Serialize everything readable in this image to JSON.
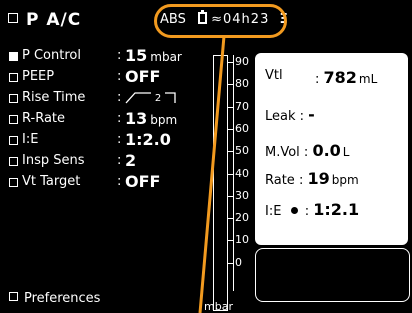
{
  "mode": {
    "title": "P A/C"
  },
  "status": {
    "abs_label": "ABS",
    "battery_time": "≈04h23",
    "marker_glyph": "Ξ"
  },
  "params": [
    {
      "label": "P Control",
      "value": "15",
      "unit": "mbar",
      "selected": true
    },
    {
      "label": "PEEP",
      "value": "OFF",
      "unit": ""
    },
    {
      "label": "Rise Time",
      "value": "2",
      "unit": ""
    },
    {
      "label": "R-Rate",
      "value": "13",
      "unit": "bpm"
    },
    {
      "label": "I:E",
      "value": "1:2.0",
      "unit": ""
    },
    {
      "label": "Insp Sens",
      "value": "2",
      "unit": ""
    },
    {
      "label": "Vt Target",
      "value": "OFF",
      "unit": ""
    }
  ],
  "preferences_label": "Preferences",
  "gauge": {
    "unit": "mbar",
    "ticks": [
      "90",
      "80",
      "70",
      "60",
      "50",
      "40",
      "30",
      "20",
      "10",
      "0"
    ]
  },
  "measured": {
    "vti": {
      "label": "Vtl",
      "value": "782",
      "unit": "mL"
    },
    "leak": {
      "label": "Leak :",
      "value": "-"
    },
    "mvol": {
      "label": "M.Vol :",
      "value": "0.0",
      "unit": "L"
    },
    "rate": {
      "label": "Rate :",
      "value": "19",
      "unit": "bpm"
    },
    "ie": {
      "label": "I:E",
      "value": "1:2.1"
    }
  },
  "colors": {
    "highlight": "#f29a1f",
    "background": "#000000",
    "panel": "#ffffff"
  }
}
